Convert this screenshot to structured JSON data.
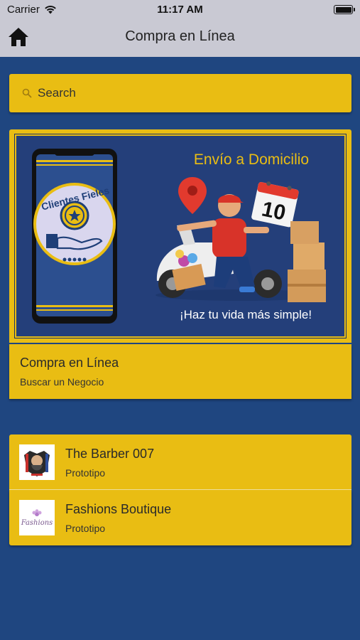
{
  "status_bar": {
    "carrier": "Carrier",
    "time": "11:17 AM"
  },
  "nav": {
    "title": "Compra en Línea",
    "home_icon": "home-icon"
  },
  "search": {
    "placeholder": "Search"
  },
  "banner": {
    "heading": "Envío a Domicilio",
    "tagline": "¡Haz tu vida más simple!",
    "badge_text": "Clientes Fieles",
    "calendar_day": "10"
  },
  "online_card": {
    "title": "Compra en Línea",
    "subtitle": "Buscar un Negocio"
  },
  "businesses": [
    {
      "name": "The Barber 007",
      "subtitle": "Prototipo"
    },
    {
      "name": "Fashions Boutique",
      "subtitle": "Prototipo",
      "logo_text": "Fashions"
    }
  ],
  "colors": {
    "background": "#1f4680",
    "accent": "#e9bd13",
    "nav": "#c9c9d3"
  }
}
